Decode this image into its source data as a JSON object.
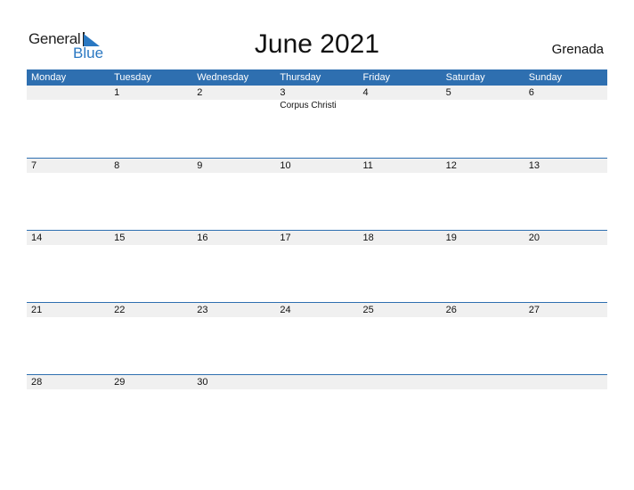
{
  "logo": {
    "word1": "General",
    "word2": "Blue"
  },
  "title": "June 2021",
  "country": "Grenada",
  "colors": {
    "header_bg": "#2e6fb0",
    "day_row_bg": "#f0f0f0",
    "brand_blue": "#2a78c2"
  },
  "weekdays": [
    "Monday",
    "Tuesday",
    "Wednesday",
    "Thursday",
    "Friday",
    "Saturday",
    "Sunday"
  ],
  "weeks": [
    {
      "days": [
        "",
        "1",
        "2",
        "3",
        "4",
        "5",
        "6"
      ],
      "events": [
        "",
        "",
        "",
        "Corpus Christi",
        "",
        "",
        ""
      ]
    },
    {
      "days": [
        "7",
        "8",
        "9",
        "10",
        "11",
        "12",
        "13"
      ],
      "events": [
        "",
        "",
        "",
        "",
        "",
        "",
        ""
      ]
    },
    {
      "days": [
        "14",
        "15",
        "16",
        "17",
        "18",
        "19",
        "20"
      ],
      "events": [
        "",
        "",
        "",
        "",
        "",
        "",
        ""
      ]
    },
    {
      "days": [
        "21",
        "22",
        "23",
        "24",
        "25",
        "26",
        "27"
      ],
      "events": [
        "",
        "",
        "",
        "",
        "",
        "",
        ""
      ]
    },
    {
      "days": [
        "28",
        "29",
        "30",
        "",
        "",
        "",
        ""
      ],
      "events": [
        "",
        "",
        "",
        "",
        "",
        "",
        ""
      ]
    }
  ]
}
